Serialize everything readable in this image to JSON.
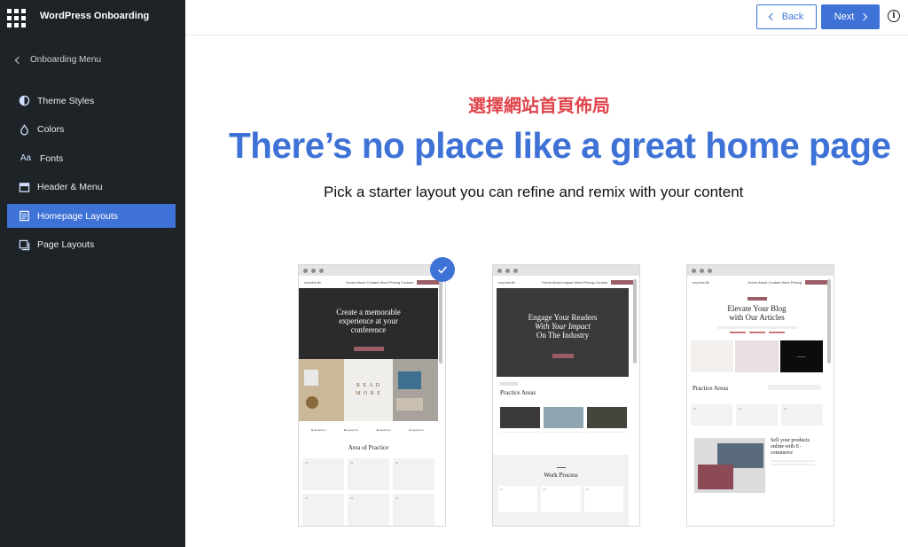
{
  "app": {
    "title": "WordPress Onboarding"
  },
  "sidebar": {
    "back_label": "Onboarding Menu",
    "items": [
      {
        "label": "Theme Styles",
        "icon": "half-circle-icon",
        "active": false
      },
      {
        "label": "Colors",
        "icon": "droplet-icon",
        "active": false
      },
      {
        "label": "Fonts",
        "icon": "font-aa-icon",
        "active": false
      },
      {
        "label": "Header & Menu",
        "icon": "header-layout-icon",
        "active": false
      },
      {
        "label": "Homepage Layouts",
        "icon": "page-icon",
        "active": true
      },
      {
        "label": "Page Layouts",
        "icon": "pages-icon",
        "active": false
      }
    ]
  },
  "toolbar": {
    "back_label": "Back",
    "next_label": "Next",
    "info_label": "i"
  },
  "main": {
    "annotation": "選擇網站首頁佈局",
    "title": "There’s no place like a great home page",
    "subtitle": "Pick a starter layout you can refine and remix with your content"
  },
  "layouts": [
    {
      "selected": true,
      "hero": "Create a memorable experience at your conference",
      "section_title": "Area of Practice",
      "tile_numbers": [
        "01",
        "02",
        "03",
        "04",
        "05",
        "06"
      ]
    },
    {
      "selected": false,
      "hero_line1": "Engage Your Readers",
      "hero_line2": "With Your Impact",
      "hero_line3": "On The Industry",
      "section_title": "Practice Areas",
      "section2_title": "Work Process",
      "tile_numbers": [
        "01",
        "02",
        "03"
      ]
    },
    {
      "selected": false,
      "hero": "Elevate Your Blog with Our Articles",
      "section_title": "Practice Areas",
      "promo_title": "Sell your products online with E-commerce",
      "tile_numbers": [
        "01",
        "02",
        "03"
      ]
    }
  ],
  "colors": {
    "accent": "#3e72d6",
    "sidebar_bg": "#1e2327",
    "annotation": "#e0454c",
    "mauve": "#9b5d66"
  }
}
